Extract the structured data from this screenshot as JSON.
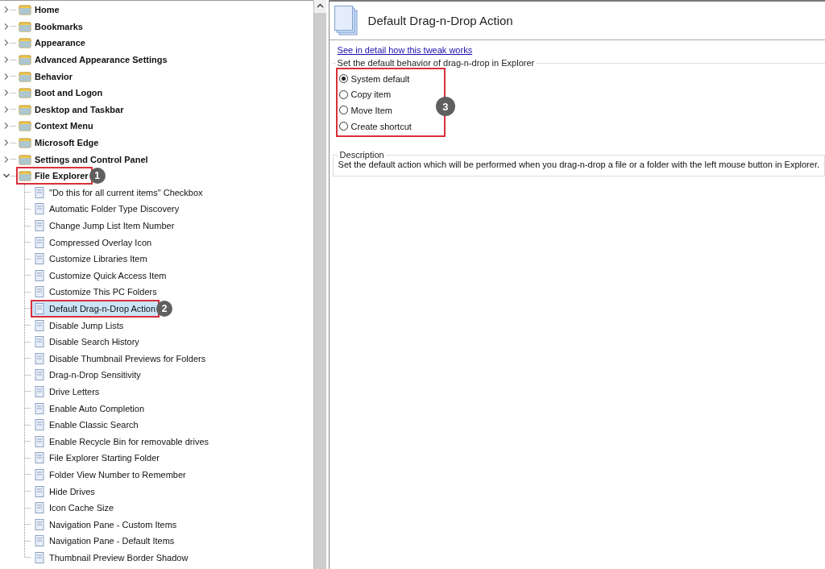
{
  "tree": [
    {
      "label": "Home",
      "expanded": false,
      "selected": false
    },
    {
      "label": "Bookmarks",
      "expanded": false,
      "selected": false
    },
    {
      "label": "Appearance",
      "expanded": false,
      "selected": false
    },
    {
      "label": "Advanced Appearance Settings",
      "expanded": false,
      "selected": false
    },
    {
      "label": "Behavior",
      "expanded": false,
      "selected": false
    },
    {
      "label": "Boot and Logon",
      "expanded": false,
      "selected": false
    },
    {
      "label": "Desktop and Taskbar",
      "expanded": false,
      "selected": false
    },
    {
      "label": "Context Menu",
      "expanded": false,
      "selected": false
    },
    {
      "label": "Microsoft Edge",
      "expanded": false,
      "selected": false
    },
    {
      "label": "Settings and Control Panel",
      "expanded": false,
      "selected": false
    },
    {
      "label": "File Explorer",
      "expanded": true,
      "selected": false,
      "callout": "1",
      "children": [
        {
          "label": "\"Do this for all current items\" Checkbox",
          "selected": false
        },
        {
          "label": "Automatic Folder Type Discovery",
          "selected": false
        },
        {
          "label": "Change Jump List Item Number",
          "selected": false
        },
        {
          "label": "Compressed Overlay Icon",
          "selected": false
        },
        {
          "label": "Customize Libraries Item",
          "selected": false
        },
        {
          "label": "Customize Quick Access Item",
          "selected": false
        },
        {
          "label": "Customize This PC Folders",
          "selected": false
        },
        {
          "label": "Default Drag-n-Drop Action",
          "selected": true,
          "callout": "2"
        },
        {
          "label": "Disable Jump Lists",
          "selected": false
        },
        {
          "label": "Disable Search History",
          "selected": false
        },
        {
          "label": "Disable Thumbnail Previews for Folders",
          "selected": false
        },
        {
          "label": "Drag-n-Drop Sensitivity",
          "selected": false
        },
        {
          "label": "Drive Letters",
          "selected": false
        },
        {
          "label": "Enable Auto Completion",
          "selected": false
        },
        {
          "label": "Enable Classic Search",
          "selected": false
        },
        {
          "label": "Enable Recycle Bin for removable drives",
          "selected": false
        },
        {
          "label": "File Explorer Starting Folder",
          "selected": false
        },
        {
          "label": "Folder View Number to Remember",
          "selected": false
        },
        {
          "label": "Hide Drives",
          "selected": false
        },
        {
          "label": "Icon Cache Size",
          "selected": false
        },
        {
          "label": "Navigation Pane - Custom Items",
          "selected": false
        },
        {
          "label": "Navigation Pane - Default Items",
          "selected": false
        },
        {
          "label": "Thumbnail Preview Border Shadow",
          "selected": false
        }
      ]
    }
  ],
  "detail": {
    "title": "Default Drag-n-Drop Action",
    "link": "See in detail how this tweak works",
    "options_group": {
      "legend": "Set the default behavior of drag-n-drop in Explorer",
      "callout": "3",
      "options": [
        {
          "label": "System default",
          "selected": true
        },
        {
          "label": "Copy item",
          "selected": false
        },
        {
          "label": "Move Item",
          "selected": false
        },
        {
          "label": "Create shortcut",
          "selected": false
        }
      ]
    },
    "description": {
      "legend": "Description",
      "text": "Set the default action which will be performed when you drag-n-drop a file or a folder with the left mouse button in Explorer."
    }
  }
}
